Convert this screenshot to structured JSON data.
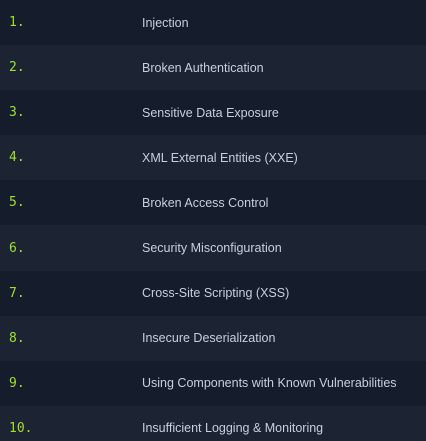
{
  "colors": {
    "number": "#a2e021",
    "text": "#c6d0dc",
    "row_dark": "#151c2b",
    "row_light": "#1c2433"
  },
  "items": [
    {
      "number": "1.",
      "label": "Injection"
    },
    {
      "number": "2.",
      "label": "Broken Authentication"
    },
    {
      "number": "3.",
      "label": "Sensitive Data Exposure"
    },
    {
      "number": "4.",
      "label": "XML External Entities (XXE)"
    },
    {
      "number": "5.",
      "label": "Broken Access Control"
    },
    {
      "number": "6.",
      "label": "Security Misconfiguration"
    },
    {
      "number": "7.",
      "label": "Cross-Site Scripting (XSS)"
    },
    {
      "number": "8.",
      "label": "Insecure Deserialization"
    },
    {
      "number": "9.",
      "label": "Using Components with Known Vulnerabilities"
    },
    {
      "number": "10.",
      "label": "Insufficient Logging & Monitoring"
    }
  ]
}
